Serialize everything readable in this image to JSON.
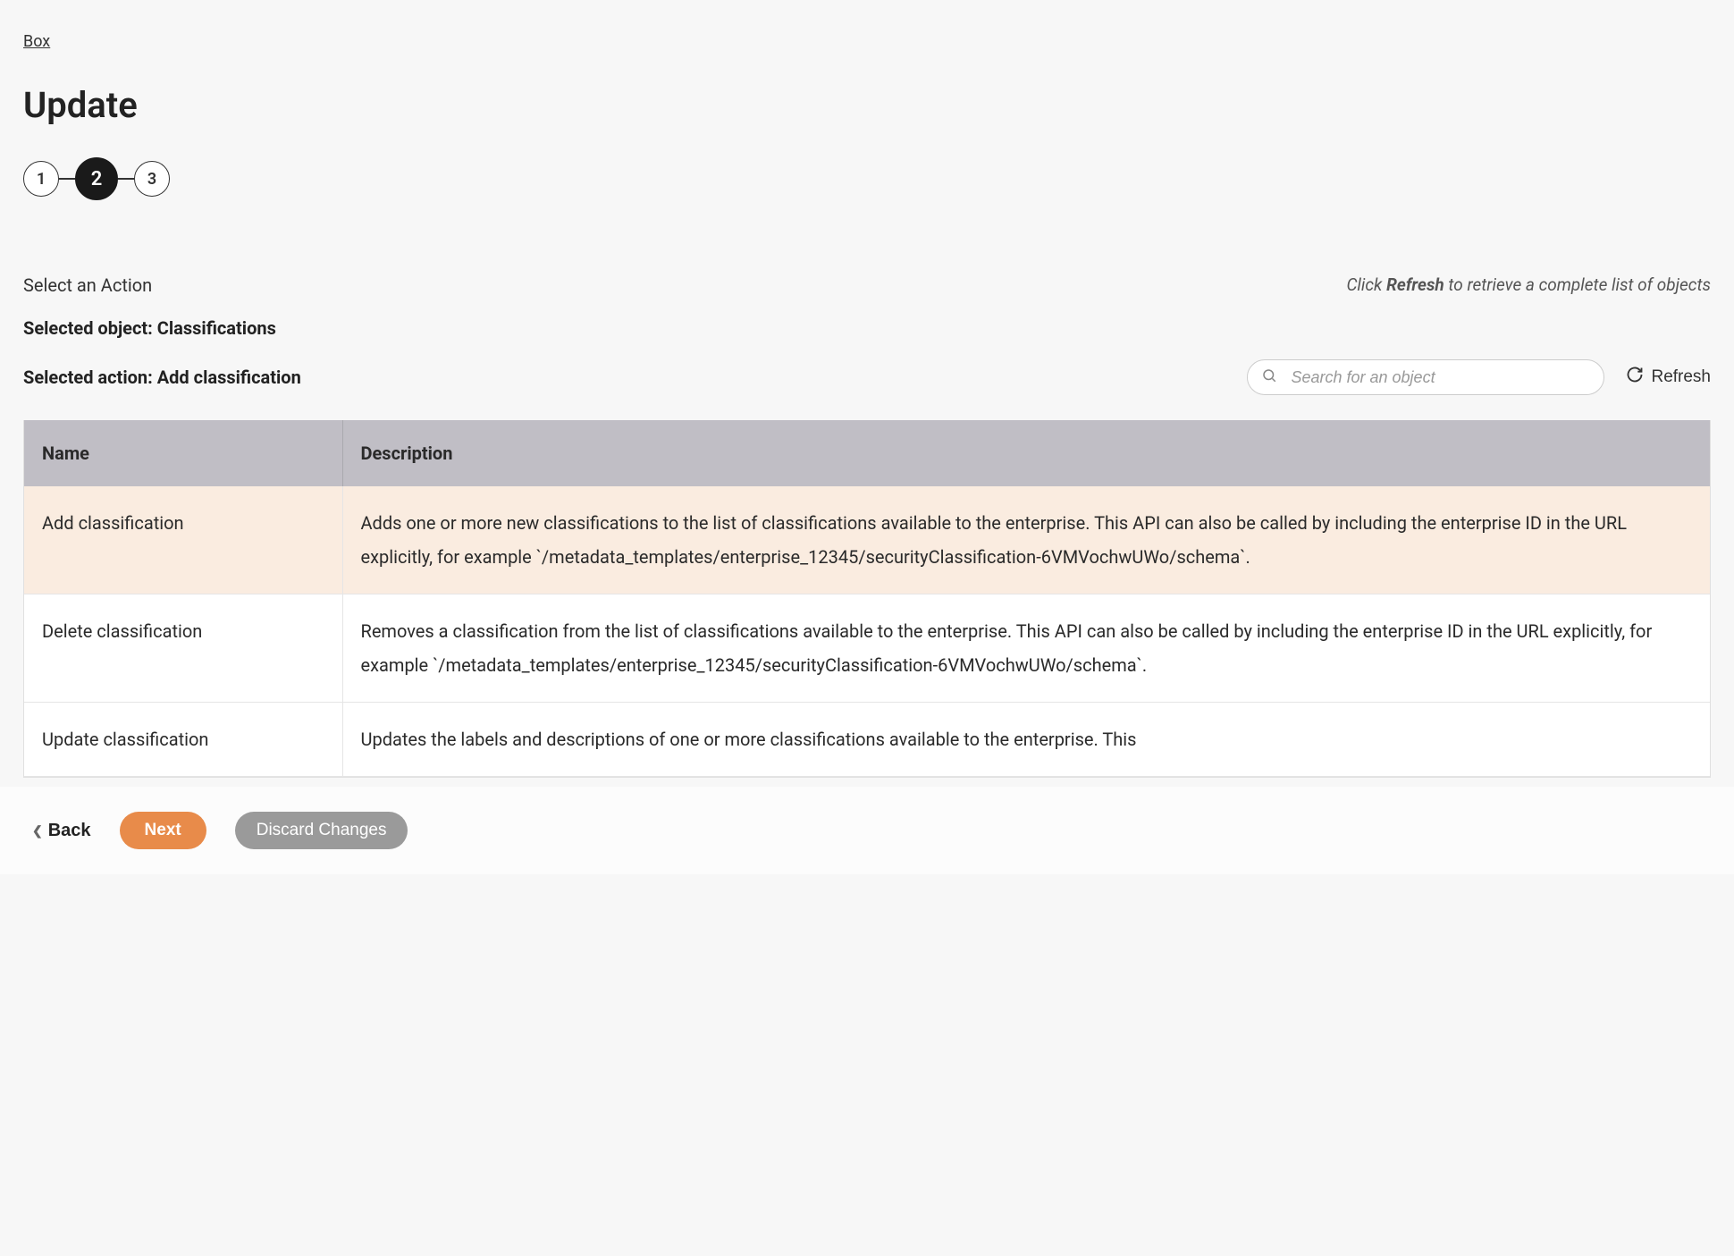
{
  "breadcrumb": "Box",
  "page_title": "Update",
  "stepper": {
    "steps": [
      "1",
      "2",
      "3"
    ],
    "active_index": 1
  },
  "labels": {
    "select_action": "Select an Action",
    "hint_prefix": "Click ",
    "hint_bold": "Refresh",
    "hint_suffix": " to retrieve a complete list of objects",
    "selected_object_prefix": "Selected object: ",
    "selected_object_value": "Classifications",
    "selected_action_prefix": "Selected action: ",
    "selected_action_value": "Add classification"
  },
  "search": {
    "placeholder": "Search for an object"
  },
  "refresh_label": "Refresh",
  "table": {
    "headers": {
      "name": "Name",
      "description": "Description"
    },
    "rows": [
      {
        "name": "Add classification",
        "description": "Adds one or more new classifications to the list of classifications available to the enterprise. This API can also be called by including the enterprise ID in the URL explicitly, for example `/metadata_templates/enterprise_12345/securityClassification-6VMVochwUWo/schema`.",
        "selected": true
      },
      {
        "name": "Delete classification",
        "description": "Removes a classification from the list of classifications available to the enterprise. This API can also be called by including the enterprise ID in the URL explicitly, for example `/metadata_templates/enterprise_12345/securityClassification-6VMVochwUWo/schema`.",
        "selected": false
      },
      {
        "name": "Update classification",
        "description": "Updates the labels and descriptions of one or more classifications available to the enterprise. This",
        "selected": false
      }
    ]
  },
  "footer": {
    "back": "Back",
    "next": "Next",
    "discard": "Discard Changes"
  }
}
